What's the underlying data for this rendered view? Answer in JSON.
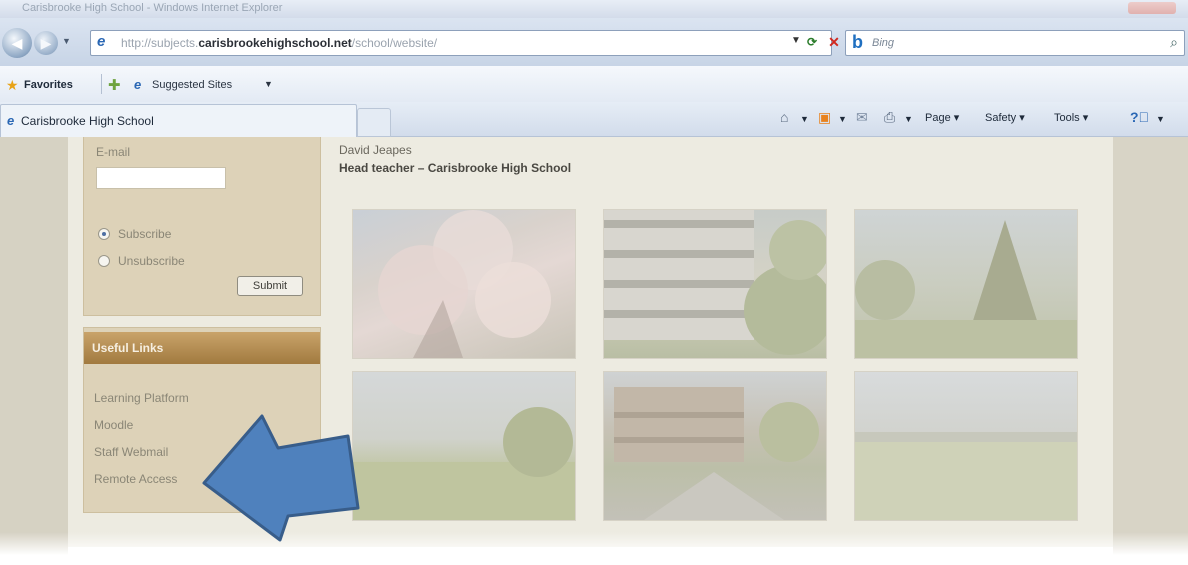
{
  "browser": {
    "window_title": "Carisbrooke High School - Windows Internet Explorer",
    "url_prefix": "http://subjects.",
    "url_domain": "carisbrookehighschool.net",
    "url_path": "/school/website/",
    "search_placeholder": "Bing",
    "favorites_label": "Favorites",
    "suggested_sites_label": "Suggested Sites",
    "tab_title": "Carisbrooke High School",
    "command_bar": {
      "page_label": "Page",
      "safety_label": "Safety",
      "tools_label": "Tools"
    }
  },
  "subscribe": {
    "email_label": "E-mail",
    "email_value": "",
    "options": [
      "Subscribe",
      "Unsubscribe"
    ],
    "selected_option": "Subscribe",
    "submit_label": "Submit"
  },
  "useful_links": {
    "heading": "Useful Links",
    "links": [
      "Learning Platform",
      "Moodle",
      "Staff Webmail",
      "Remote Access"
    ]
  },
  "signoff": {
    "name": "David Jeapes",
    "role": "Head teacher – Carisbrooke High School"
  },
  "annotation": {
    "arrow_color": "#4f81bd",
    "arrow_outline": "#385d8a"
  }
}
